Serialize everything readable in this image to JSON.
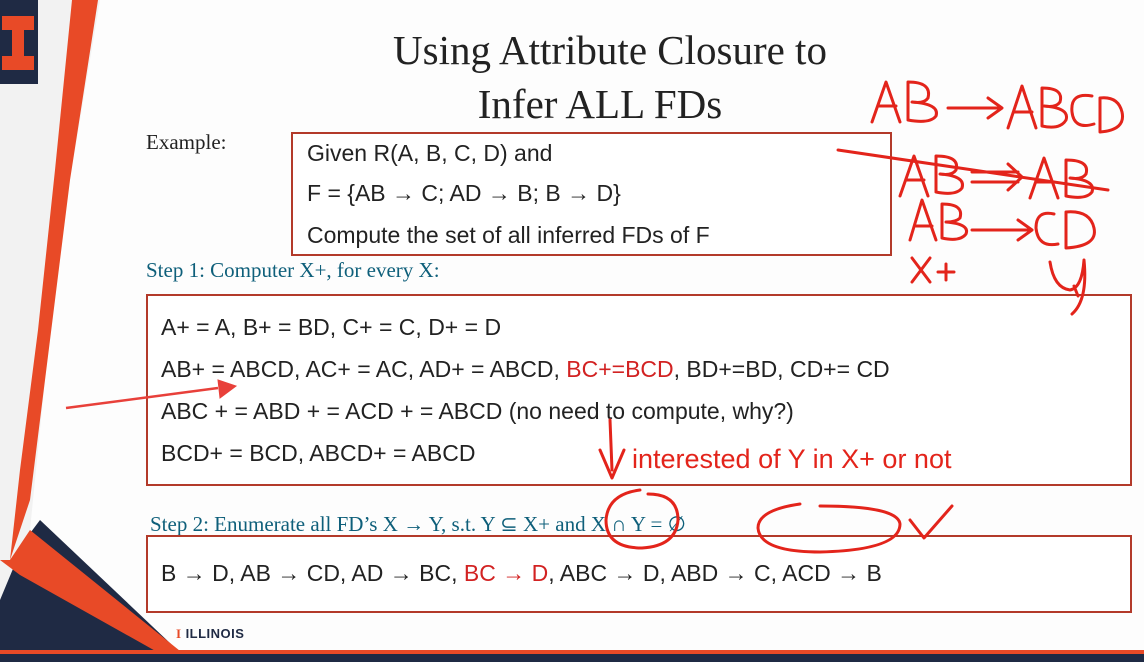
{
  "slide": {
    "title_line1": "Using Attribute Closure to",
    "title_line2": "Infer ALL FDs",
    "example_label": "Example:",
    "given": {
      "line1": "Given R(A, B, C, D) and",
      "line2": "F = {AB → C; AD → B; B  → D}",
      "line3": "Compute the set of all inferred FDs of F"
    },
    "step1_heading": "Step 1: Computer X+, for every X:",
    "closure": {
      "line1": "A+ = A,   B+ = BD,   C+ = C,   D+ = D",
      "line2_a": "AB+ = ABCD,   AC+ = AC,   AD+ = ABCD, ",
      "line2_red": "BC+=BCD",
      "line2_b": ", BD+=BD, CD+= CD",
      "line3": "ABC + = ABD + = ACD + = ABCD (no need to compute, why?)",
      "line4": "BCD+ = BCD,    ABCD+ = ABCD"
    },
    "annotation": "interested of Y in X+ or not",
    "step2_heading": "Step 2: Enumerate all FD’s X → Y, s.t. Y ⊆ X+ and X ∩ Y =  ∅",
    "enum": {
      "part_a": "B → D, AB →  CD, AD → BC,  ",
      "part_red": "BC → D",
      "part_b": ",  ABC → D, ABD → C,   ACD → B"
    },
    "footer_logo": "ILLINOIS",
    "footer_logo_mark": "I",
    "colors": {
      "accent_orange": "#e84a27",
      "navy": "#1f2a44",
      "box_border": "#b33a2a",
      "heading_teal": "#0e5f7a",
      "red_text": "#d22222",
      "ink_red": "#e3241b"
    }
  }
}
